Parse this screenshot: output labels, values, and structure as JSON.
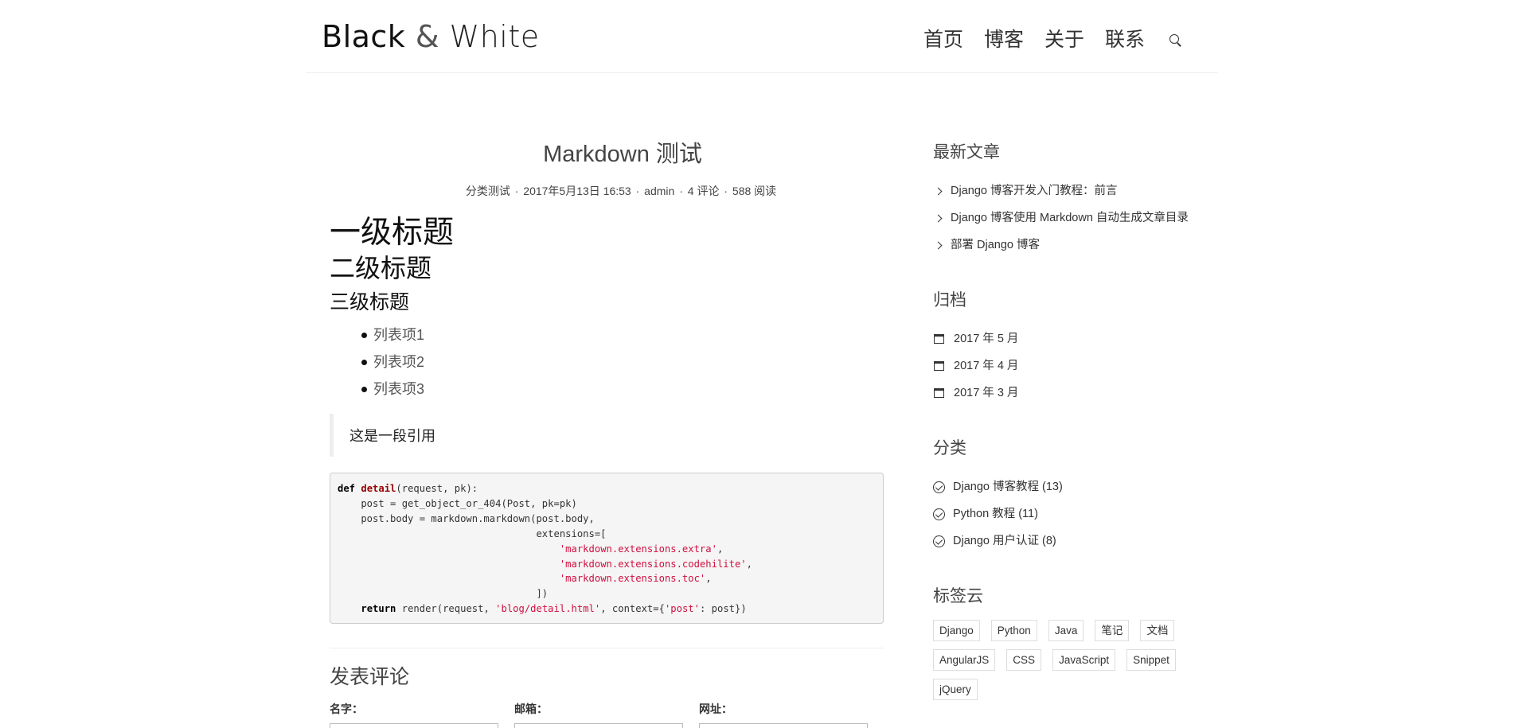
{
  "site": {
    "logo_black": "Black",
    "logo_amp": "&",
    "logo_white": "White",
    "nav": [
      "首页",
      "博客",
      "关于",
      "联系"
    ]
  },
  "post": {
    "title": "Markdown 测试",
    "meta": {
      "category": "分类测试",
      "date": "2017年5月13日 16:53",
      "author": "admin",
      "comments": "4 评论",
      "views": "588 阅读",
      "separator": "·"
    },
    "h1": "一级标题",
    "h2": "二级标题",
    "h3": "三级标题",
    "list": [
      "列表项1",
      "列表项2",
      "列表项3"
    ],
    "quote": "这是一段引用",
    "code": {
      "l1_kw": "def",
      "l1_fn": "detail",
      "l1_rest": "(request, pk):",
      "l2": "    post = get_object_or_404(Post, pk=pk)",
      "l3": "    post.body = markdown.markdown(post.body,",
      "l4": "                                  extensions=[",
      "l5_indent": "                                      ",
      "l5_str": "'markdown.extensions.extra'",
      "l5_end": ",",
      "l6_indent": "                                      ",
      "l6_str": "'markdown.extensions.codehilite'",
      "l6_end": ",",
      "l7_indent": "                                      ",
      "l7_str": "'markdown.extensions.toc'",
      "l7_end": ",",
      "l8": "                                  ])",
      "l9_indent": "    ",
      "l9_kw": "return",
      "l9_a": " render(request, ",
      "l9_str1": "'blog/detail.html'",
      "l9_b": ", context={",
      "l9_str2": "'post'",
      "l9_c": ": post})"
    }
  },
  "comments": {
    "title": "发表评论",
    "name_label": "名字：",
    "email_label": "邮箱：",
    "url_label": "网址："
  },
  "sidebar": {
    "recent_title": "最新文章",
    "recent": [
      "Django 博客开发入门教程：前言",
      "Django 博客使用 Markdown 自动生成文章目录",
      "部署 Django 博客"
    ],
    "archive_title": "归档",
    "archives": [
      "2017 年 5 月",
      "2017 年 4 月",
      "2017 年 3 月"
    ],
    "category_title": "分类",
    "categories": [
      "Django 博客教程 (13)",
      "Python 教程 (11)",
      "Django 用户认证 (8)"
    ],
    "tags_title": "标签云",
    "tags": [
      "Django",
      "Python",
      "Java",
      "笔记",
      "文档",
      "AngularJS",
      "CSS",
      "JavaScript",
      "Snippet",
      "jQuery"
    ]
  }
}
